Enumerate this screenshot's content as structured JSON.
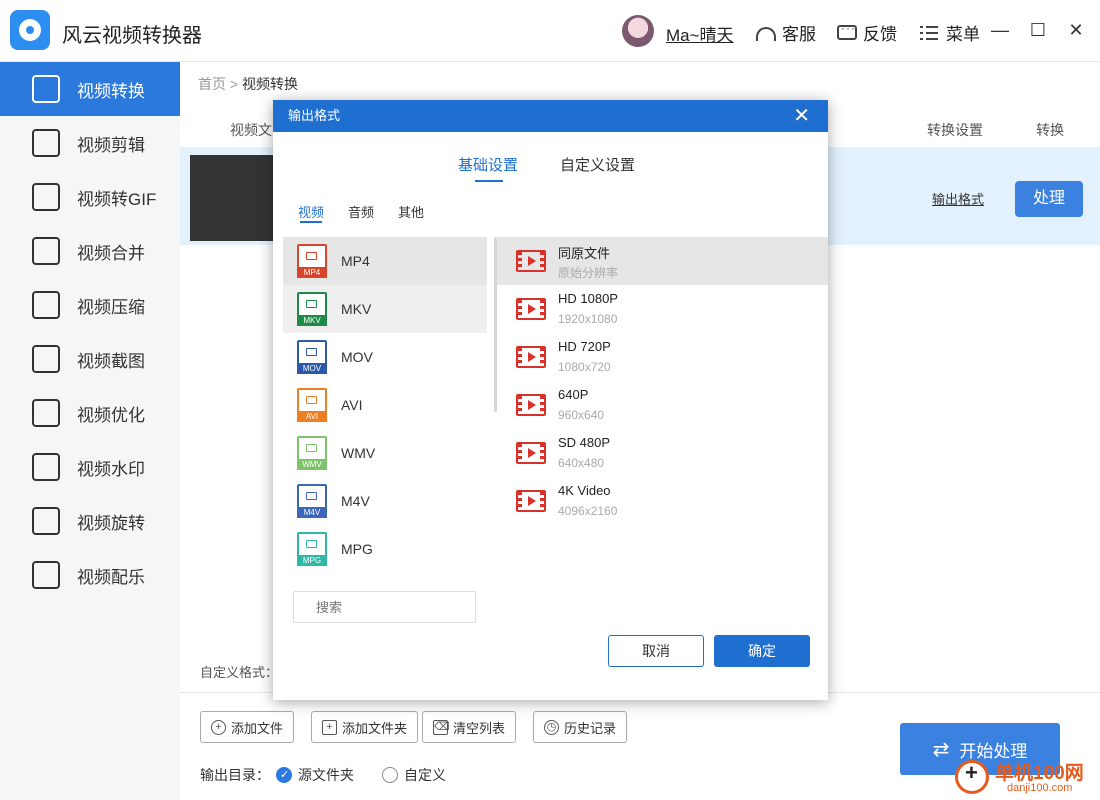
{
  "app": {
    "title": "风云视频转换器",
    "username": "Ma~晴天"
  },
  "titlebar": {
    "service": "客服",
    "feedback": "反馈",
    "menu": "菜单",
    "minimize": "—",
    "maximize": "☐",
    "close": "✕"
  },
  "sidebar": {
    "items": [
      {
        "label": "视频转换",
        "icon": "video-convert-icon",
        "active": true
      },
      {
        "label": "视频剪辑",
        "icon": "clapperboard-icon"
      },
      {
        "label": "视频转GIF",
        "icon": "gif-icon"
      },
      {
        "label": "视频合并",
        "icon": "merge-icon"
      },
      {
        "label": "视频压缩",
        "icon": "compress-icon"
      },
      {
        "label": "视频截图",
        "icon": "crop-icon"
      },
      {
        "label": "视频优化",
        "icon": "optimize-icon"
      },
      {
        "label": "视频水印",
        "icon": "watermark-icon"
      },
      {
        "label": "视频旋转",
        "icon": "rotate-icon"
      },
      {
        "label": "视频配乐",
        "icon": "music-icon"
      }
    ]
  },
  "breadcrumb": {
    "home": "首页",
    "separator": ">",
    "current": "视频转换"
  },
  "table": {
    "col_file": "视频文",
    "col_settings": "转换设置",
    "col_convert": "转换"
  },
  "file_row": {
    "output_format": "输出格式",
    "process": "处理"
  },
  "custom_format_label": "自定义格式：",
  "bottom": {
    "add_file": "添加文件",
    "add_folder": "添加文件夹",
    "clear_list": "清空列表",
    "history": "历史记录",
    "output_dir_label": "输出目录：",
    "option_source": "源文件夹",
    "option_custom": "自定义",
    "start": "开始处理"
  },
  "watermark": {
    "text": "单机100网",
    "sub": "danji100.com"
  },
  "modal": {
    "title": "输出格式",
    "tabs": [
      "基础设置",
      "自定义设置"
    ],
    "subtabs": [
      "视频",
      "音频",
      "其他"
    ],
    "formats": [
      {
        "name": "MP4",
        "color": "#d9452b"
      },
      {
        "name": "MKV",
        "color": "#1e8a4a"
      },
      {
        "name": "MOV",
        "color": "#2c5aa8"
      },
      {
        "name": "AVI",
        "color": "#ef7d22"
      },
      {
        "name": "WMV",
        "color": "#7cc36b"
      },
      {
        "name": "M4V",
        "color": "#3c66b8"
      },
      {
        "name": "MPG",
        "color": "#2fb8a6"
      }
    ],
    "resolutions": [
      {
        "name": "同原文件",
        "dim": "原始分辨率"
      },
      {
        "name": "HD 1080P",
        "dim": "1920x1080"
      },
      {
        "name": "HD 720P",
        "dim": "1080x720"
      },
      {
        "name": "640P",
        "dim": "960x640"
      },
      {
        "name": "SD 480P",
        "dim": "640x480"
      },
      {
        "name": "4K Video",
        "dim": "4096x2160"
      }
    ],
    "search_placeholder": "搜索",
    "cancel": "取消",
    "ok": "确定"
  },
  "colors": {
    "accent": "#2b79dc",
    "modal_header": "#1f6fd1",
    "row_highlight": "#e3f1fd",
    "film_red": "#d9312b"
  }
}
